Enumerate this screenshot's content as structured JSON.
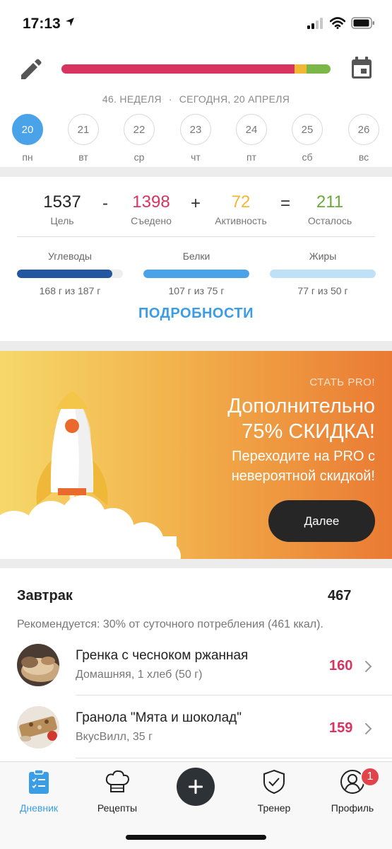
{
  "status": {
    "time": "17:13"
  },
  "header": {
    "week_label": "46. НЕДЕЛЯ",
    "separator": "·",
    "date_label": "СЕГОДНЯ, 20 АПРЕЛЯ",
    "progress": [
      {
        "fraction": 0.865,
        "color": "#d9335f"
      },
      {
        "fraction": 0.045,
        "color": "#f0b933"
      },
      {
        "fraction": 0.09,
        "color": "#7ab648"
      }
    ],
    "days": [
      {
        "num": "20",
        "name": "пн",
        "selected": true
      },
      {
        "num": "21",
        "name": "вт"
      },
      {
        "num": "22",
        "name": "ср"
      },
      {
        "num": "23",
        "name": "чт"
      },
      {
        "num": "24",
        "name": "пт"
      },
      {
        "num": "25",
        "name": "сб"
      },
      {
        "num": "26",
        "name": "вс"
      }
    ]
  },
  "calories": {
    "goal_value": "1537",
    "goal_label": "Цель",
    "minus": "-",
    "eaten_value": "1398",
    "eaten_label": "Съедено",
    "plus": "+",
    "activity_value": "72",
    "activity_label": "Активность",
    "equals": "=",
    "left_value": "211",
    "left_label": "Осталось",
    "colors": {
      "goal": "#222222",
      "eaten": "#d9335f",
      "activity": "#f0b933",
      "left": "#6aaa3c"
    }
  },
  "macros": {
    "carbs": {
      "label": "Углеводы",
      "value": "168 г из 187 г",
      "fraction": 0.9,
      "color": "#2356a0"
    },
    "protein": {
      "label": "Белки",
      "value": "107 г из 75 г",
      "fraction": 1.0,
      "color": "#4aa3e8"
    },
    "fat": {
      "label": "Жиры",
      "value": "77 г из 50 г",
      "fraction": 1.0,
      "color": "#bfe0f7"
    }
  },
  "details_label": "ПОДРОБНОСТИ",
  "promo": {
    "eyebrow": "СТАТЬ PRO!",
    "headline_1": "Дополнительно",
    "headline_2": "75% СКИДКА!",
    "sub_1": "Переходите на PRO с",
    "sub_2": "невероятной скидкой!",
    "button": "Далее"
  },
  "meal": {
    "title": "Завтрак",
    "kcal": "467",
    "recommendation": "Рекомендуется: 30% от суточного потребления (461 ккал).",
    "items": [
      {
        "name": "Гренка с чесноком ржанная",
        "meta": "Домашняя, 1 хлеб (50 г)",
        "kcal": "160"
      },
      {
        "name": "Гранола \"Мята и шоколад\"",
        "meta": "ВкусВилл, 35 г",
        "kcal": "159"
      }
    ]
  },
  "tabs": {
    "diary": "Дневник",
    "recipes": "Рецепты",
    "coach": "Тренер",
    "profile": "Профиль",
    "profile_badge": "1"
  }
}
